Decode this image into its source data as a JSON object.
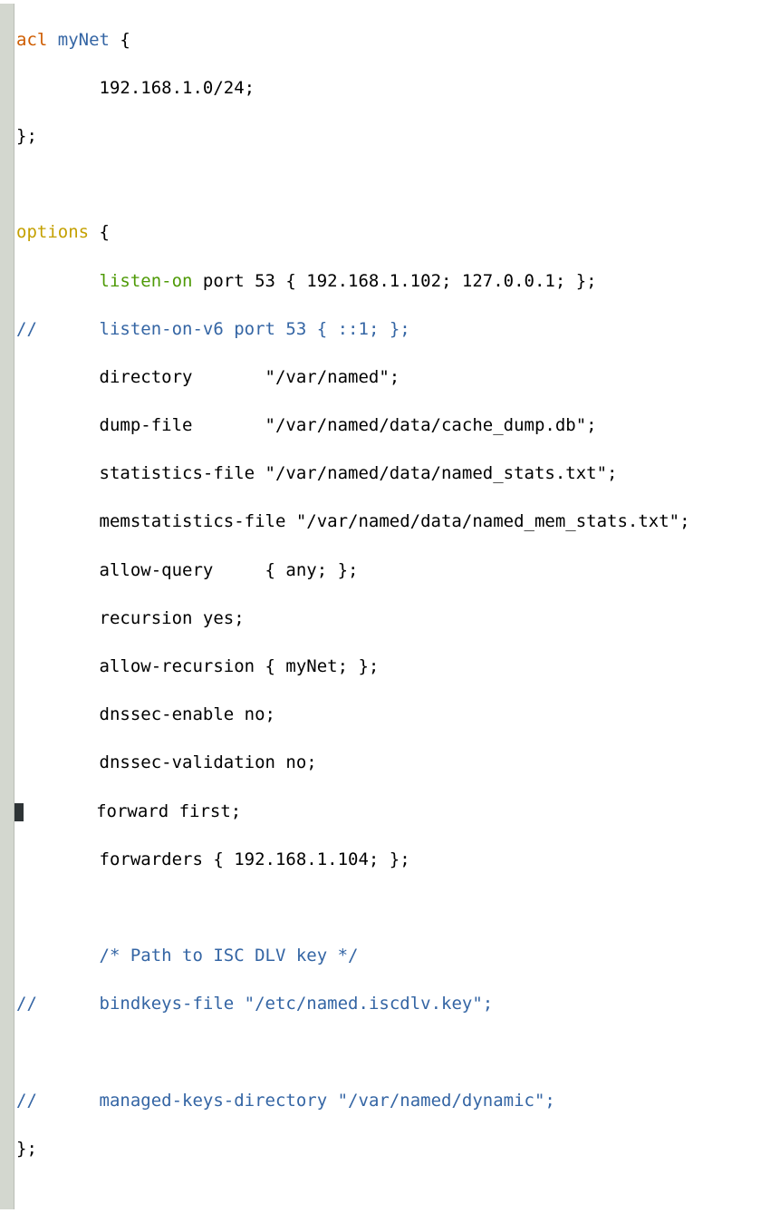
{
  "code": {
    "acl_keyword": "acl",
    "acl_name": "myNet",
    "acl_open": " {",
    "acl_cidr": "        192.168.1.0/24;",
    "acl_close": "};",
    "options_keyword": "options",
    "options_open": " {",
    "listen_on": "listen-on",
    "listen_on_rest": " port 53 { 192.168.1.102; 127.0.0.1; };",
    "comment1_slashes": "//",
    "comment1_body": "      listen-on-v6 port 53 { ::1; };",
    "directory": "        directory       \"/var/named\";",
    "dump_file": "        dump-file       \"/var/named/data/cache_dump.db\";",
    "stats_file": "        statistics-file \"/var/named/data/named_stats.txt\";",
    "memstats_file": "        memstatistics-file \"/var/named/data/named_mem_stats.txt\";",
    "allow_query": "        allow-query     { any; };",
    "recursion": "        recursion yes;",
    "allow_recursion": "        allow-recursion { myNet; };",
    "dnssec_enable": "        dnssec-enable no;",
    "dnssec_validation": "        dnssec-validation no;",
    "forward_first": "       forward first;",
    "forwarders": "        forwarders { 192.168.1.104; };",
    "path_comment": "        /* Path to ISC DLV key */",
    "comment2_slashes": "//",
    "comment2_body": "      bindkeys-file \"/etc/named.iscdlv.key\";",
    "comment3_slashes": "//",
    "comment3_body": "      managed-keys-directory \"/var/named/dynamic\";",
    "options_close": "};",
    "indent8": "        "
  }
}
